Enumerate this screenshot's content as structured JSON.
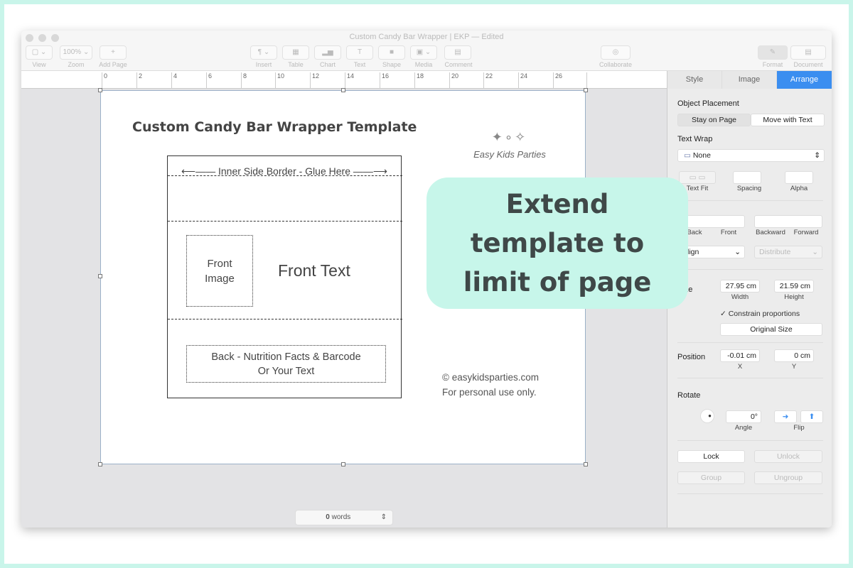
{
  "window": {
    "title": "Custom Candy Bar Wrapper | EKP — Edited"
  },
  "toolbar": {
    "view": "View",
    "zoom_value": "100%",
    "zoom": "Zoom",
    "add_page": "Add Page",
    "insert": "Insert",
    "table": "Table",
    "chart": "Chart",
    "text": "Text",
    "shape": "Shape",
    "media": "Media",
    "comment": "Comment",
    "collaborate": "Collaborate",
    "format": "Format",
    "document": "Document"
  },
  "ruler": [
    "0",
    "2",
    "4",
    "6",
    "8",
    "10",
    "12",
    "14",
    "16",
    "18",
    "20",
    "22",
    "24",
    "26"
  ],
  "doc": {
    "heading": "Custom Candy Bar Wrapper Template",
    "border": "Inner Side Border - Glue Here",
    "front_image": "Front Image",
    "front_text": "Front Text",
    "back_line1": "Back - Nutrition Facts & Barcode",
    "back_line2": "Or Your Text",
    "logo": "Easy Kids Parties",
    "site": "easykidsparties.com",
    "personal": "For personal use only.",
    "copyright": "©"
  },
  "status": {
    "count": "0",
    "words": "words"
  },
  "sidebar": {
    "tabs": [
      "Style",
      "Image",
      "Arrange"
    ],
    "active_tab": "Arrange",
    "accent": "#3b8ef0",
    "object_placement": "Object Placement",
    "stay": "Stay on Page",
    "move": "Move with Text",
    "text_wrap": "Text Wrap",
    "wrap_value": "None",
    "text_fit": "Text Fit",
    "spacing": "Spacing",
    "alpha": "Alpha",
    "back": "Back",
    "front": "Front",
    "backward": "Backward",
    "forward": "Forward",
    "align": "Align",
    "distribute": "Distribute",
    "size": "Size",
    "width": "27.95 cm",
    "width_l": "Width",
    "height": "21.59 cm",
    "height_l": "Height",
    "constrain": "✓ Constrain proportions",
    "original": "Original Size",
    "position": "Position",
    "x": "-0.01 cm",
    "x_l": "X",
    "y": "0 cm",
    "y_l": "Y",
    "rotate": "Rotate",
    "angle": "0°",
    "angle_l": "Angle",
    "flip": "Flip",
    "lock": "Lock",
    "unlock": "Unlock",
    "group": "Group",
    "ungroup": "Ungroup"
  },
  "callout": {
    "text": "Extend template to limit of page",
    "color": "#c7f6ea"
  }
}
